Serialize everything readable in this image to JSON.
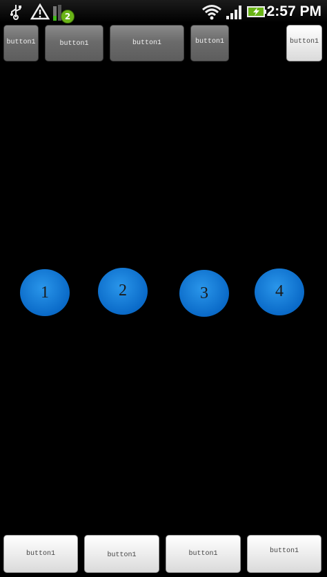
{
  "status_bar": {
    "time": "2:57",
    "time_suffix": "PM",
    "notification_count": "2",
    "icons": [
      "usb-icon",
      "warning-icon",
      "signal-bars-icon",
      "wifi-icon",
      "cell-signal-icon",
      "battery-charging-icon"
    ]
  },
  "top_buttons": [
    {
      "label": "button1"
    },
    {
      "label": "button1"
    },
    {
      "label": "button1"
    },
    {
      "label": "button1"
    },
    {
      "label": "button1"
    }
  ],
  "circles": [
    {
      "label": "1"
    },
    {
      "label": "2"
    },
    {
      "label": "3"
    },
    {
      "label": "4"
    }
  ],
  "bottom_buttons": [
    {
      "label": "button1"
    },
    {
      "label": "button1"
    },
    {
      "label": "button1"
    },
    {
      "label": "button1"
    }
  ],
  "colors": {
    "circle_blue": "#0a7ad8",
    "battery_green": "#6ab417"
  }
}
